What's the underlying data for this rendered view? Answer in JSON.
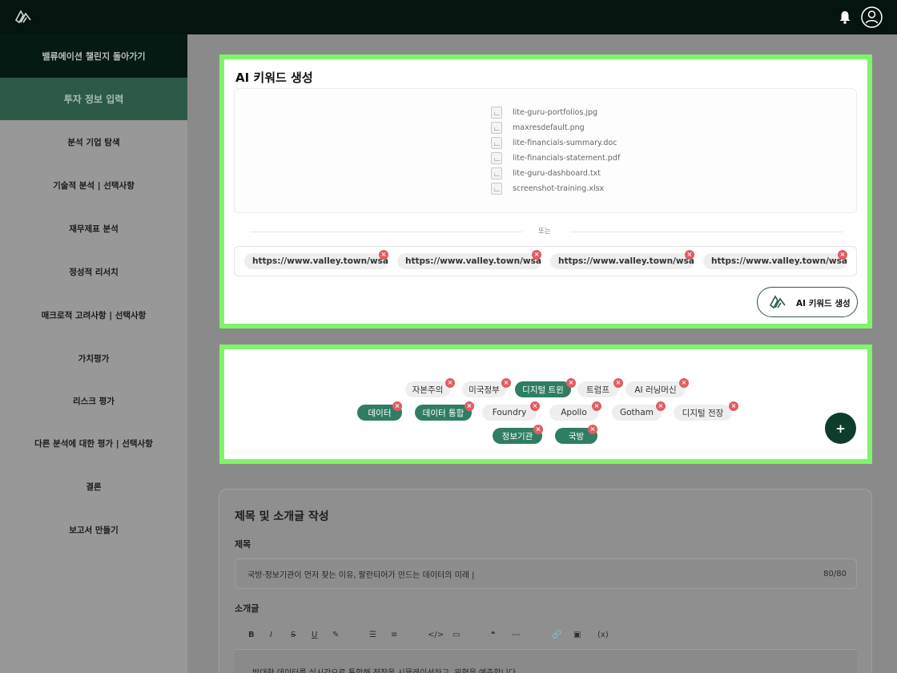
{
  "sidebar": {
    "back_label": "밸류에이션 챌린지 돌아가기",
    "active_label": "투자 정보 입력",
    "items": [
      "분석 기업 탐색",
      "기술적 분석 | 선택사항",
      "재무제표 분석",
      "정성적 리서치",
      "매크로적 고려사항 | 선택사항",
      "가치평가",
      "리스크 평가",
      "다른 분석에 대한 평가 | 선택사항",
      "결론",
      "보고서 만들기"
    ]
  },
  "keyword_card": {
    "title": "AI 키워드 생성",
    "files": [
      "lite-guru-portfolios.jpg",
      "maxresdefault.png",
      "lite-financials-summary.doc",
      "lite-financials-statement.pdf",
      "lite-guru-dashboard.txt",
      "screenshot-training.xlsx"
    ],
    "or_text": "또는",
    "urls": [
      "https://www.valley.town/wsaj...",
      "https://www.valley.town/wsaj...",
      "https://www.valley.town/wsaj...",
      "https://www.valley.town/wsaj..."
    ],
    "generate_label": "AI 키워드 생성"
  },
  "keywords": {
    "row1": [
      {
        "label": "자본주의",
        "selected": false
      },
      {
        "label": "미국정부",
        "selected": false
      },
      {
        "label": "디지털 트윈",
        "selected": true
      },
      {
        "label": "트럼프",
        "selected": false
      },
      {
        "label": "AI 러닝머신",
        "selected": false
      }
    ],
    "row2": [
      {
        "label": "데이터",
        "selected": true
      },
      {
        "label": "데이터 통합",
        "selected": true
      },
      {
        "label": "Foundry",
        "selected": false
      },
      {
        "label": "Apollo",
        "selected": false
      },
      {
        "label": "Gotham",
        "selected": false
      },
      {
        "label": "디지털 전장",
        "selected": false
      }
    ],
    "row3": [
      {
        "label": "정보기관",
        "selected": true
      },
      {
        "label": "국방",
        "selected": true
      }
    ],
    "add_label": "+"
  },
  "form": {
    "heading": "제목 및 소개글 작성",
    "title_label": "제목",
    "title_value": "국방·정보기관이 먼저 찾는 이유, 팔란티어가 만드는 데이터의 미래 |",
    "title_count": "80/80",
    "intro_label": "소개글",
    "toolbar": [
      "B",
      "I",
      "S",
      "U",
      "✎",
      "☰",
      "≡",
      "</>",
      "▭",
      "❝",
      "---",
      "🔗",
      "▣",
      "(x)"
    ],
    "intro_text": "방대한 데이터를 실시간으로 통합해 전장을 시뮬레이션하고, 위협을 예측합니다."
  },
  "colors": {
    "highlight": "#7ff46a",
    "brand_green": "#2f7d62",
    "dark_green": "#0e3d2c",
    "close_red": "#e25c63"
  }
}
